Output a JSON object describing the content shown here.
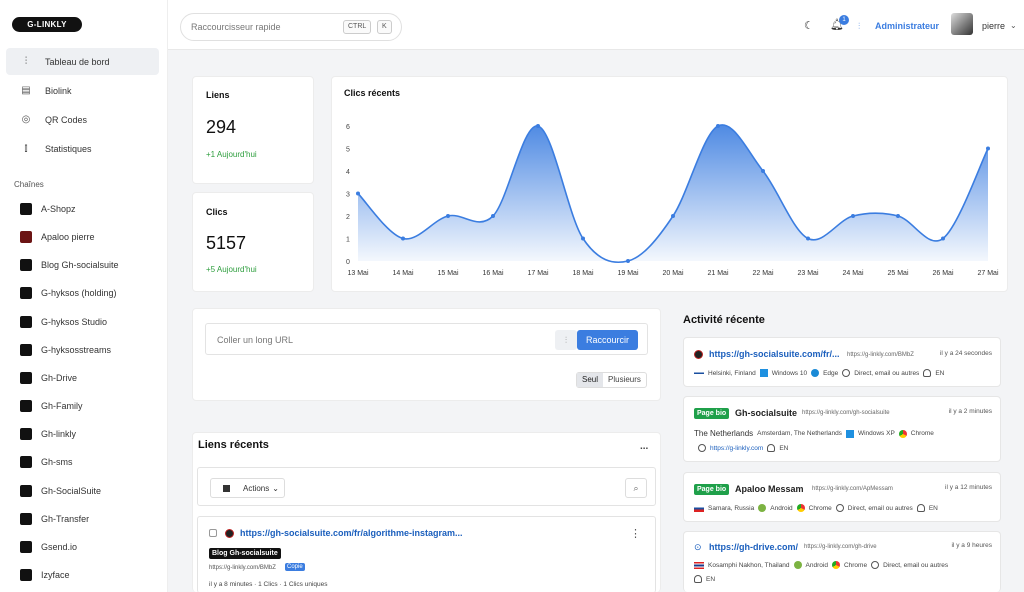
{
  "app": {
    "logo": "G-LINKLY"
  },
  "sidebar": {
    "nav": [
      {
        "label": "Tableau de bord",
        "icon": "sliders-icon"
      },
      {
        "label": "Biolink",
        "icon": "page-icon"
      },
      {
        "label": "QR Codes",
        "icon": "qr-icon"
      },
      {
        "label": "Statistiques",
        "icon": "bar-chart-icon"
      }
    ],
    "section_title": "Chaînes",
    "channels": [
      {
        "label": "A-Shopz",
        "color": "#111111"
      },
      {
        "label": "Apaloo pierre",
        "color": "#6b1414"
      },
      {
        "label": "Blog Gh-socialsuite",
        "color": "#111111"
      },
      {
        "label": "G-hyksos (holding)",
        "color": "#111111"
      },
      {
        "label": "G-hyksos Studio",
        "color": "#111111"
      },
      {
        "label": "G-hyksosstreams",
        "color": "#111111"
      },
      {
        "label": "Gh-Drive",
        "color": "#111111"
      },
      {
        "label": "Gh-Family",
        "color": "#111111"
      },
      {
        "label": "Gh-linkly",
        "color": "#111111"
      },
      {
        "label": "Gh-sms",
        "color": "#111111"
      },
      {
        "label": "Gh-SocialSuite",
        "color": "#111111"
      },
      {
        "label": "Gh-Transfer",
        "color": "#111111"
      },
      {
        "label": "Gsend.io",
        "color": "#111111"
      },
      {
        "label": "Izyface",
        "color": "#111111"
      }
    ]
  },
  "topbar": {
    "search_placeholder": "Raccourcisseur rapide",
    "kbd1": "CTRL",
    "kbd2": "K",
    "notification_count": "1",
    "admin_label": "Administrateur",
    "user_name": "pierre"
  },
  "stats": {
    "links": {
      "title": "Liens",
      "value": "294",
      "delta": "+1 Aujourd'hui"
    },
    "clicks": {
      "title": "Clics",
      "value": "5157",
      "delta": "+5 Aujourd'hui"
    }
  },
  "chart_data": {
    "type": "area",
    "title": "Clics récents",
    "categories": [
      "13 Mai",
      "14 Mai",
      "15 Mai",
      "16 Mai",
      "17 Mai",
      "18 Mai",
      "19 Mai",
      "20 Mai",
      "21 Mai",
      "22 Mai",
      "23 Mai",
      "24 Mai",
      "25 Mai",
      "26 Mai",
      "27 Mai"
    ],
    "values": [
      3,
      1,
      2,
      2,
      6,
      1,
      0,
      2,
      6,
      4,
      1,
      2,
      2,
      1,
      5
    ],
    "ylim": [
      0,
      6
    ],
    "yticks": [
      0,
      1,
      2,
      3,
      4,
      5,
      6
    ],
    "color": "#3b7de0"
  },
  "shorten": {
    "placeholder": "Coller un long URL",
    "button": "Raccourcir",
    "seg_single": "Seul",
    "seg_multi": "Plusieurs"
  },
  "recent_links": {
    "title": "Liens récents",
    "more": "...",
    "actions": "Actions",
    "item": {
      "url": "https://gh-socialsuite.com/fr/algorithme-instagram...",
      "channel": "Blog Gh-socialsuite",
      "short": "https://g-linkly.com/BMbZ",
      "copy": "Copie",
      "footer": "il y a 8 minutes · 1 Clics · 1 Clics uniques"
    }
  },
  "activity": {
    "title": "Activité récente",
    "items": [
      {
        "badge": "",
        "title": "https://gh-socialsuite.com/fr/...",
        "short": "https://g-linkly.com/BMbZ",
        "time": "il y a 24 secondes",
        "location": "Helsinki, Finland",
        "os": "Windows 10",
        "browser": "Edge",
        "referrer": "Direct, email ou autres",
        "lang": "EN",
        "extra": ""
      },
      {
        "badge": "Page bio",
        "title": "Gh-socialsuite",
        "short": "https://g-linkly.com/gh-socialsuite",
        "time": "il y a 2 minutes",
        "location": "The Netherlands",
        "location2": "Amsterdam, The Netherlands",
        "os": "Windows XP",
        "browser": "Chrome",
        "referrer": "https://g-linkly.com",
        "lang": "EN"
      },
      {
        "badge": "Page bio",
        "title": "Apaloo Messam",
        "short": "https://g-linkly.com/ApMessam",
        "time": "il y a 12 minutes",
        "location": "Samara, Russia",
        "os": "Android",
        "browser": "Chrome",
        "referrer": "Direct, email ou autres",
        "lang": "EN"
      },
      {
        "badge": "",
        "title": "https://gh-drive.com/",
        "short": "https://g-linkly.com/gh-drive",
        "time": "il y a 9 heures",
        "location": "Kosamphi Nakhon, Thailand",
        "os": "Android",
        "browser": "Chrome",
        "referrer": "Direct, email ou autres",
        "lang": "EN"
      }
    ]
  }
}
